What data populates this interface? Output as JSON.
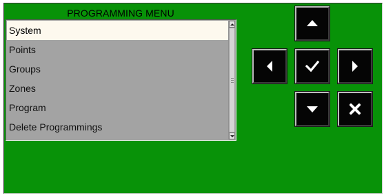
{
  "menu": {
    "title": "PROGRAMMING MENU",
    "items": [
      {
        "label": "System",
        "selected": true
      },
      {
        "label": "Points",
        "selected": false
      },
      {
        "label": "Groups",
        "selected": false
      },
      {
        "label": "Zones",
        "selected": false
      },
      {
        "label": "Program",
        "selected": false
      },
      {
        "label": "Delete Programmings",
        "selected": false
      }
    ]
  },
  "nav_buttons": {
    "up": "arrow-up-icon",
    "left": "arrow-left-icon",
    "confirm": "checkmark-icon",
    "right": "arrow-right-icon",
    "down": "arrow-down-icon",
    "cancel": "cross-icon"
  },
  "colors": {
    "panel_background": "#089208",
    "list_background": "#a3a3a3",
    "selected_item_background": "#fdf9ee",
    "button_background": "#050505",
    "button_icon": "#ffffff"
  }
}
